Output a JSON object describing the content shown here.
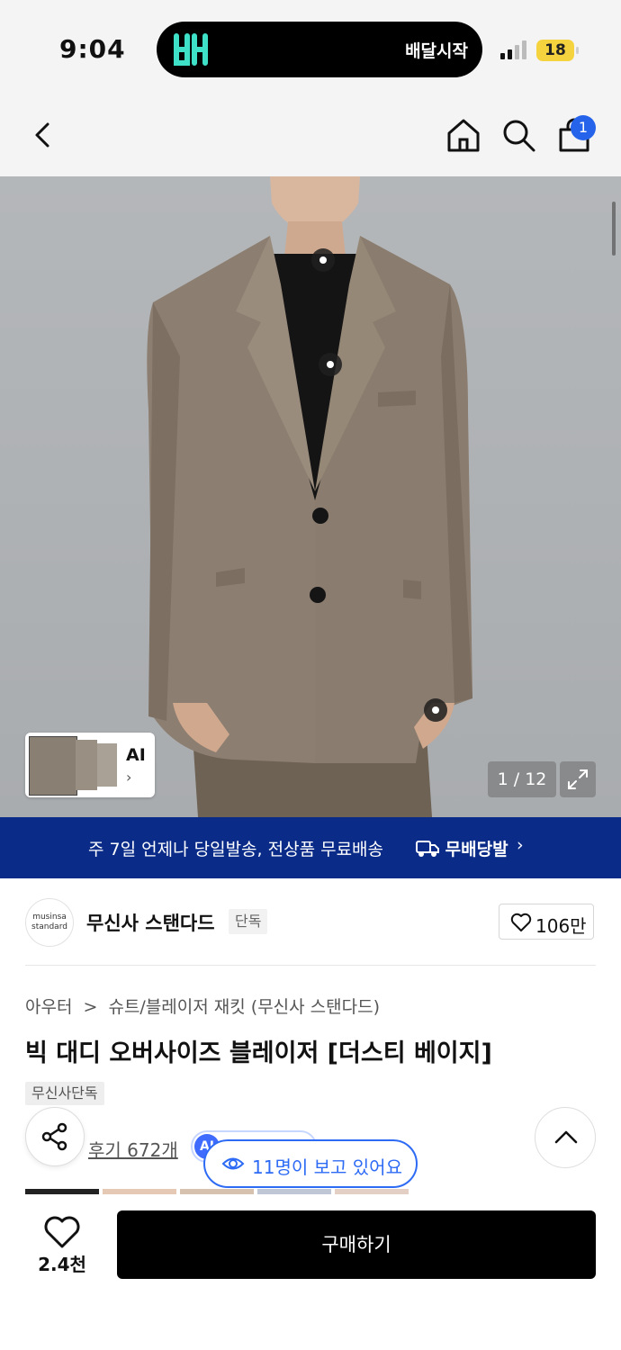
{
  "status_bar": {
    "time": "9:04",
    "island_text": "배달시작",
    "battery": "18",
    "island_logo_color": "#3ee0c8"
  },
  "nav": {
    "cart_count": "1",
    "icons": [
      "back-icon",
      "home-icon",
      "search-icon",
      "cart-icon"
    ]
  },
  "gallery": {
    "ai_label": "AI",
    "ai_chevron": "›",
    "page_indicator": "1 / 12"
  },
  "banner": {
    "text": "주 7일 언제나 당일발송, 전상품 무료배송",
    "logo_text": "무배당발",
    "chevron": "›",
    "background": "#0a2c88"
  },
  "brand": {
    "logo_line1": "musinsa",
    "logo_line2": "standard",
    "name": "무신사 스탠다드",
    "tag": "단독",
    "like_count": "106만"
  },
  "product": {
    "breadcrumb_1": "아우터",
    "breadcrumb_sep": ">",
    "breadcrumb_2": "슈트/블레이저 재킷 (무신사 스탠다드)",
    "title": "빅 대디 오버사이즈 블레이저 [더스티 베이지]",
    "exclusive_badge": "무신사단독",
    "review_link": "후기 672개",
    "ai_pill_icon": "AI",
    "viewing_text": "11명이 보고 있어요"
  },
  "bottom_bar": {
    "like_count": "2.4천",
    "buy_label": "구매하기"
  },
  "colors": {
    "accent_blue": "#2e6bf5",
    "badge_blue": "#2563eb"
  }
}
